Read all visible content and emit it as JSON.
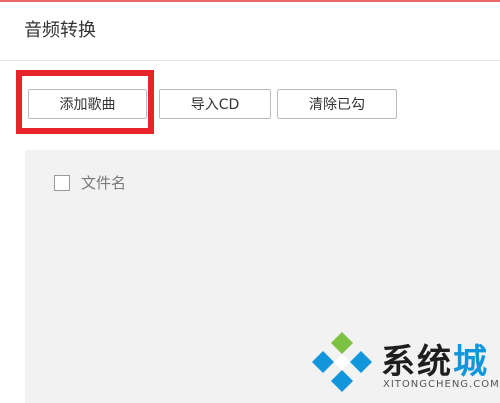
{
  "window": {
    "title": "音频转换",
    "accent_color": "#e96a6a"
  },
  "toolbar": {
    "add_song_label": "添加歌曲",
    "import_cd_label": "导入CD",
    "clear_checked_label": "清除已勾"
  },
  "annotation": {
    "highlight_color": "#e8242a",
    "target": "add-song-button"
  },
  "file_list": {
    "header": {
      "select_all_checked": false,
      "filename_label": "文件名"
    },
    "rows": []
  },
  "watermark": {
    "main_text": "系统",
    "accent_text": "城",
    "subtitle": "XITONGCHENG.COM",
    "logo_icon": "diamond-logo-icon",
    "colors": {
      "blue": "#1296db",
      "green": "#7cc242",
      "text": "#1e1e1e"
    }
  }
}
